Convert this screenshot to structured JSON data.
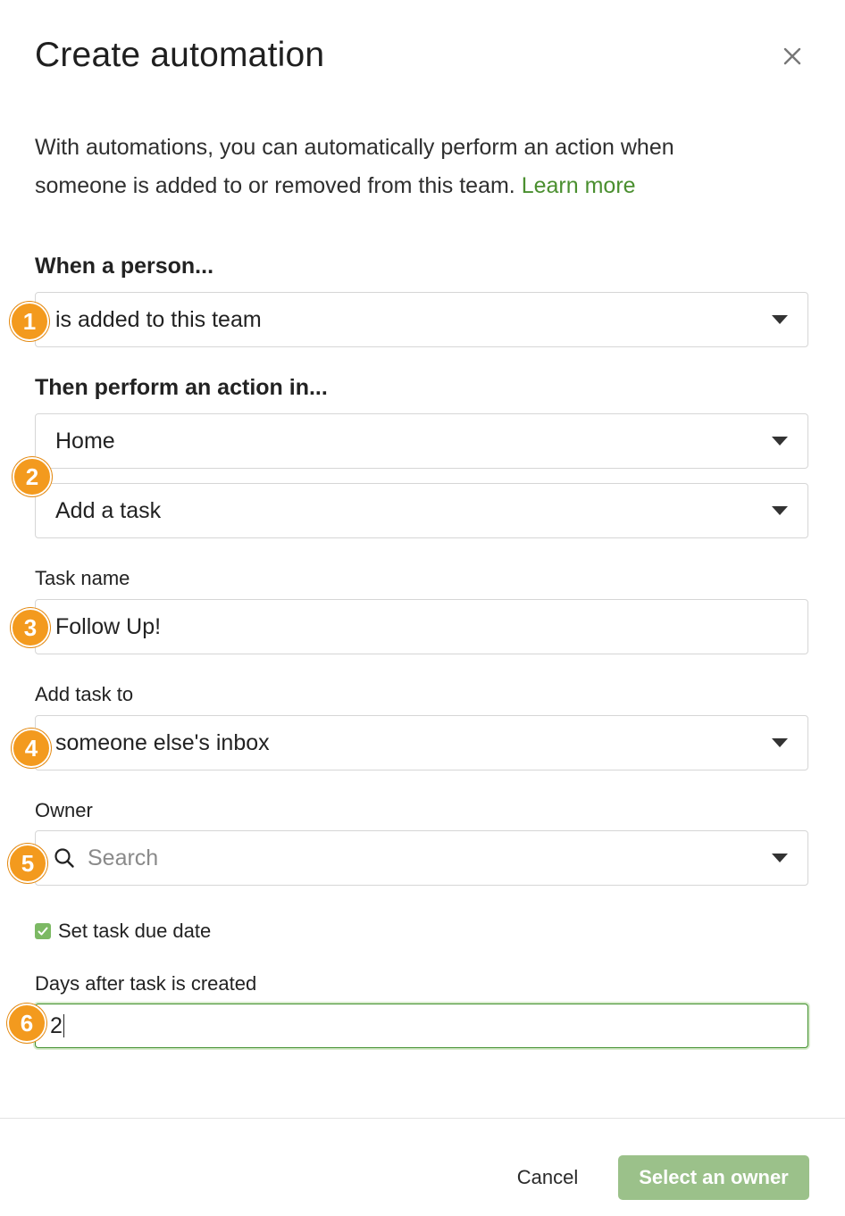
{
  "dialog": {
    "title": "Create automation",
    "close_icon": "close-icon"
  },
  "intro": {
    "text": "With automations, you can automatically perform an action when someone is added to or removed from this team.",
    "link_label": "Learn more",
    "link_color": "#4a8f2f"
  },
  "trigger": {
    "label": "When a person...",
    "value": "is added to this team",
    "badge": "1"
  },
  "action": {
    "label": "Then perform an action in...",
    "app_value": "Home",
    "action_value": "Add a task",
    "badge": "2"
  },
  "task_name": {
    "label": "Task name",
    "value": "Follow Up!",
    "badge": "3"
  },
  "add_task_to": {
    "label": "Add task to",
    "value": "someone else's inbox",
    "badge": "4"
  },
  "owner": {
    "label": "Owner",
    "placeholder": "Search",
    "icon": "search-icon",
    "badge": "5"
  },
  "due_date": {
    "checkbox_label": "Set task due date",
    "checked": true,
    "days_label": "Days after task is created",
    "days_value": "2",
    "badge": "6"
  },
  "footer": {
    "cancel_label": "Cancel",
    "primary_label": "Select an owner",
    "primary_color": "#9bc18a"
  },
  "colors": {
    "badge": "#f39a1e",
    "accent_green": "#4a8f2f",
    "checkbox_green": "#7cb964"
  }
}
